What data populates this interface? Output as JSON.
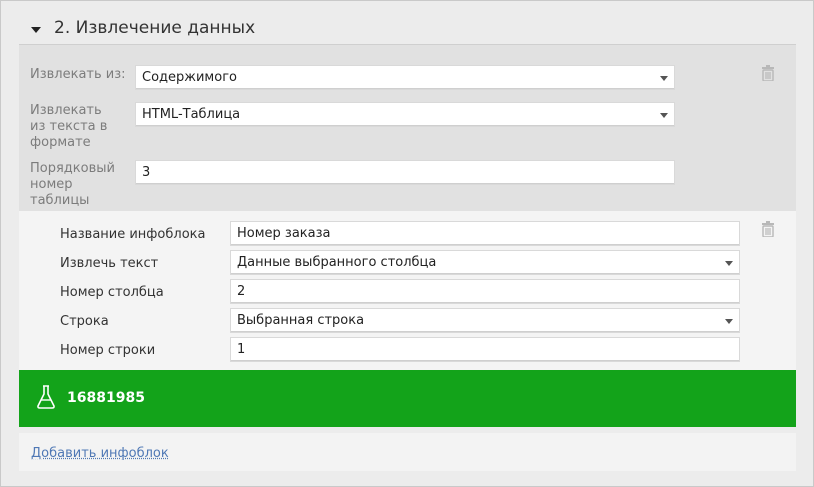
{
  "header": {
    "title": "2. Извлечение данных"
  },
  "extract": {
    "from_label": "Извлекать из:",
    "from_value": "Содержимого",
    "format_label": "Извлекать из текста в формате",
    "format_value": "HTML-Таблица",
    "table_no_label": "Порядковый номер таблицы",
    "table_no_value": "3"
  },
  "infoblock": {
    "name_label": "Название инфоблока",
    "name_value": "Номер заказа",
    "extract_text_label": "Извлечь текст",
    "extract_text_value": "Данные выбранного столбца",
    "column_label": "Номер столбца",
    "column_value": "2",
    "row_label": "Строка",
    "row_value": "Выбранная строка",
    "row_no_label": "Номер строки",
    "row_no_value": "1"
  },
  "result": {
    "value": "16881985",
    "color": "#13a31a"
  },
  "footer": {
    "add_link": "Добавить инфоблок"
  },
  "icons": {
    "collapse": "caret-down-icon",
    "delete": "trash-icon",
    "test": "flask-icon"
  }
}
